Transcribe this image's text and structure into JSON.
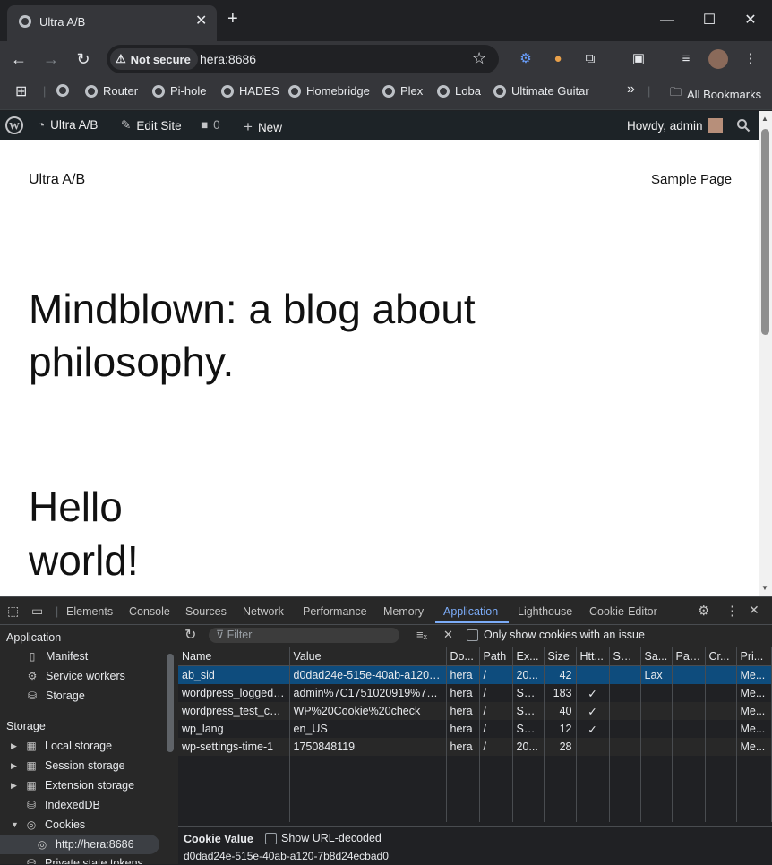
{
  "browser": {
    "tab_title": "Ultra A/B",
    "not_secure_label": "Not secure",
    "url": "hera:8686"
  },
  "bookmarks": {
    "items": [
      "Router",
      "Pi-hole",
      "HADES",
      "Homebridge",
      "Plex",
      "Loba",
      "Ultimate Guitar"
    ],
    "overflow": "»",
    "all_bookmarks": "All Bookmarks"
  },
  "wp_admin_bar": {
    "site_name": "Ultra A/B",
    "edit_site": "Edit Site",
    "comments_count": "0",
    "new_label": "New",
    "howdy": "Howdy, admin"
  },
  "page": {
    "site_title": "Ultra A/B",
    "nav_link": "Sample Page",
    "headline_line1": "Mindblown: a blog about",
    "headline_line2": "philosophy.",
    "post_title_line1": "Hello",
    "post_title_line2": "world!"
  },
  "devtools": {
    "tabs": [
      "Elements",
      "Console",
      "Sources",
      "Network",
      "Performance",
      "Memory",
      "Application",
      "Lighthouse",
      "Cookie-Editor"
    ],
    "active_tab": "Application",
    "sidebar": {
      "application_header": "Application",
      "application_items": [
        "Manifest",
        "Service workers",
        "Storage"
      ],
      "storage_header": "Storage",
      "storage_items": [
        "Local storage",
        "Session storage",
        "Extension storage",
        "IndexedDB",
        "Cookies"
      ],
      "cookie_origin": "http://hera:8686",
      "cut_off_item": "Private state tokens"
    },
    "filter_placeholder": "Filter",
    "only_issues_label": "Only show cookies with an issue",
    "columns": [
      "Name",
      "Value",
      "Do...",
      "Path",
      "Ex...",
      "Size",
      "Htt...",
      "Sec...",
      "Sa...",
      "Par...",
      "Cr...",
      "Pri..."
    ],
    "cookies": [
      {
        "name": "ab_sid",
        "value": "d0dad24e-515e-40ab-a120-7...",
        "domain": "hera",
        "path": "/",
        "expires": "20...",
        "size": "42",
        "httponly": "",
        "secure": "",
        "samesite": "Lax",
        "partition": "",
        "cross": "",
        "priority": "Me..."
      },
      {
        "name": "wordpress_logged_i...",
        "value": "admin%7C1751020919%7CN...",
        "domain": "hera",
        "path": "/",
        "expires": "Ses...",
        "size": "183",
        "httponly": "✓",
        "secure": "",
        "samesite": "",
        "partition": "",
        "cross": "",
        "priority": "Me..."
      },
      {
        "name": "wordpress_test_coo...",
        "value": "WP%20Cookie%20check",
        "domain": "hera",
        "path": "/",
        "expires": "Ses...",
        "size": "40",
        "httponly": "✓",
        "secure": "",
        "samesite": "",
        "partition": "",
        "cross": "",
        "priority": "Me..."
      },
      {
        "name": "wp_lang",
        "value": "en_US",
        "domain": "hera",
        "path": "/",
        "expires": "Ses...",
        "size": "12",
        "httponly": "✓",
        "secure": "",
        "samesite": "",
        "partition": "",
        "cross": "",
        "priority": "Me..."
      },
      {
        "name": "wp-settings-time-1",
        "value": "1750848119",
        "domain": "hera",
        "path": "/",
        "expires": "20...",
        "size": "28",
        "httponly": "",
        "secure": "",
        "samesite": "",
        "partition": "",
        "cross": "",
        "priority": "Me..."
      }
    ],
    "cookie_value_label": "Cookie Value",
    "show_url_decoded_label": "Show URL-decoded",
    "cookie_value": "d0dad24e-515e-40ab-a120-7b8d24ecbad0"
  }
}
